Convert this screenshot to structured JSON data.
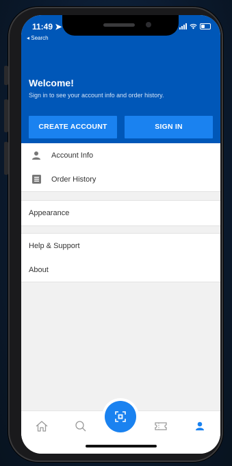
{
  "status_bar": {
    "time": "11:49 ➤",
    "back_label": "◂ Search"
  },
  "header": {
    "title": "Welcome!",
    "subtitle": "Sign in to see your account info and order history.",
    "create_account_label": "CREATE ACCOUNT",
    "sign_in_label": "SIGN IN"
  },
  "menu": {
    "account_section": [
      {
        "label": "Account Info",
        "icon": "person-icon"
      },
      {
        "label": "Order History",
        "icon": "list-icon"
      }
    ],
    "appearance_label": "Appearance",
    "support_section": [
      {
        "label": "Help & Support"
      },
      {
        "label": "About"
      }
    ]
  },
  "tab_bar": {
    "tabs": [
      "home-icon",
      "search-icon",
      "scan-icon",
      "coupon-icon",
      "account-icon"
    ],
    "active": "account-icon"
  },
  "colors": {
    "brand_blue": "#0057b8",
    "button_blue": "#1a82f0",
    "active_tab": "#1a82f0"
  }
}
